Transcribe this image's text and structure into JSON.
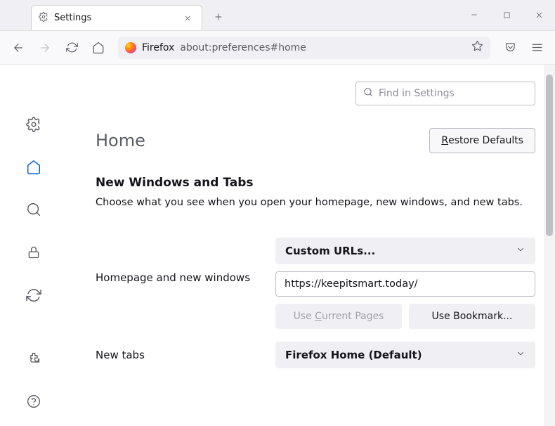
{
  "titlebar": {
    "tab_label": "Settings"
  },
  "toolbar": {
    "brand": "Firefox",
    "url": "about:preferences#home"
  },
  "search": {
    "placeholder": "Find in Settings"
  },
  "page": {
    "title": "Home",
    "restore": "Restore Defaults",
    "section_heading": "New Windows and Tabs",
    "section_desc": "Choose what you see when you open your homepage, new windows, and new tabs.",
    "homepage_label": "Homepage and new windows",
    "homepage_dropdown": "Custom URLs...",
    "homepage_value": "https://keepitsmart.today/",
    "use_current": "Use Current Pages",
    "use_bookmark": "Use Bookmark...",
    "newtabs_label": "New tabs",
    "newtabs_dropdown": "Firefox Home (Default)"
  }
}
